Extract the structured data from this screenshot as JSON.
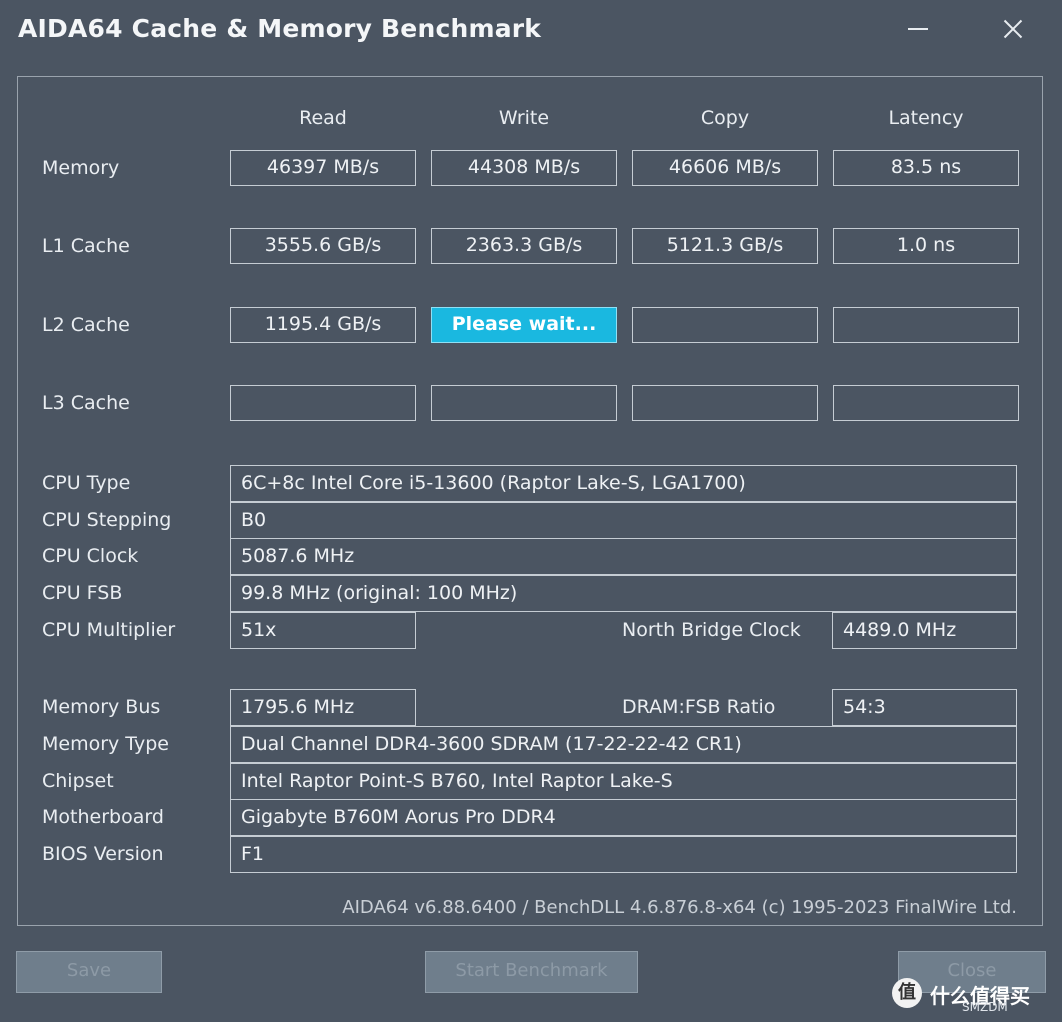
{
  "window": {
    "title": "AIDA64 Cache & Memory Benchmark"
  },
  "columns": [
    "Read",
    "Write",
    "Copy",
    "Latency"
  ],
  "bench_rows": [
    {
      "label": "Memory",
      "read": "46397 MB/s",
      "write": "44308 MB/s",
      "copy": "46606 MB/s",
      "latency": "83.5 ns"
    },
    {
      "label": "L1 Cache",
      "read": "3555.6 GB/s",
      "write": "2363.3 GB/s",
      "copy": "5121.3 GB/s",
      "latency": "1.0 ns"
    },
    {
      "label": "L2 Cache",
      "read": "1195.4 GB/s",
      "write": "Please wait...",
      "copy": "",
      "latency": ""
    },
    {
      "label": "L3 Cache",
      "read": "",
      "write": "",
      "copy": "",
      "latency": ""
    }
  ],
  "cpu": {
    "type_label": "CPU Type",
    "type": "6C+8c Intel Core i5-13600  (Raptor Lake-S, LGA1700)",
    "stepping_label": "CPU Stepping",
    "stepping": "B0",
    "clock_label": "CPU Clock",
    "clock": "5087.6 MHz",
    "fsb_label": "CPU FSB",
    "fsb": "99.8 MHz  (original: 100 MHz)",
    "multiplier_label": "CPU Multiplier",
    "multiplier": "51x",
    "nb_clock_label": "North Bridge Clock",
    "nb_clock": "4489.0 MHz"
  },
  "memory": {
    "bus_label": "Memory Bus",
    "bus": "1795.6 MHz",
    "ratio_label": "DRAM:FSB Ratio",
    "ratio": "54:3",
    "type_label": "Memory Type",
    "type": "Dual Channel DDR4-3600 SDRAM  (17-22-22-42 CR1)",
    "chipset_label": "Chipset",
    "chipset": "Intel Raptor Point-S B760, Intel Raptor Lake-S",
    "motherboard_label": "Motherboard",
    "motherboard": "Gigabyte B760M Aorus Pro DDR4",
    "bios_label": "BIOS Version",
    "bios": "F1"
  },
  "footer": "AIDA64 v6.88.6400 / BenchDLL 4.6.876.8-x64  (c) 1995-2023 FinalWire Ltd.",
  "buttons": {
    "save": "Save",
    "start": "Start Benchmark",
    "close": "Close"
  },
  "watermark": {
    "logo": "值",
    "text": "什么值得买",
    "site": "SMZDM"
  },
  "colors": {
    "background": "#4b5562",
    "wait_highlight": "#1ab8e0",
    "border": "#c5ccd3"
  }
}
